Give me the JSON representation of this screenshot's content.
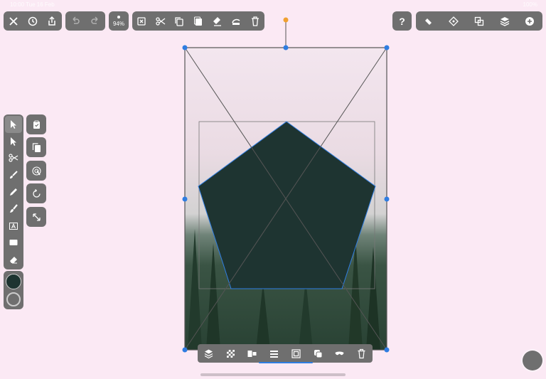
{
  "status_bar": {
    "left": "10:00  Tue 16 Feb",
    "right": "100%"
  },
  "toolbar": {
    "zoom": "94%",
    "file_icons": [
      "close-icon",
      "history-icon",
      "share-icon"
    ],
    "undo_icons": [
      "undo-icon",
      "redo-icon"
    ],
    "edit_icons": [
      "deselect-icon",
      "cut-icon",
      "copy-icon",
      "paste-icon",
      "fill-icon",
      "stroke-icon",
      "trash-icon"
    ],
    "right_icons": [
      "help-icon",
      "pen-nib-icon",
      "snap-icon",
      "boolean-icon",
      "layers-icon",
      "add-icon"
    ]
  },
  "tools": [
    "select-arrow-icon",
    "direct-select-icon",
    "scissors-tool-icon",
    "brush-icon",
    "pencil-icon",
    "paint-brush-icon",
    "text-tool-icon",
    "rectangle-tool-icon",
    "eraser-icon"
  ],
  "side_tools": [
    "clipboard-icon",
    "duplicate-icon",
    "touch-icon",
    "rotate-icon",
    "resize-icon"
  ],
  "colors": {
    "fill": "#1e3431",
    "selection": "#2f7de1",
    "handle_top": "#f0a030",
    "ui": "#6f6f6f",
    "background": "#fbe9f4"
  },
  "selection_actions": [
    "arrange-icon",
    "transparency-icon",
    "align-icon",
    "distribute-icon",
    "mask-icon",
    "group-icon",
    "visibility-icon",
    "delete-icon"
  ]
}
